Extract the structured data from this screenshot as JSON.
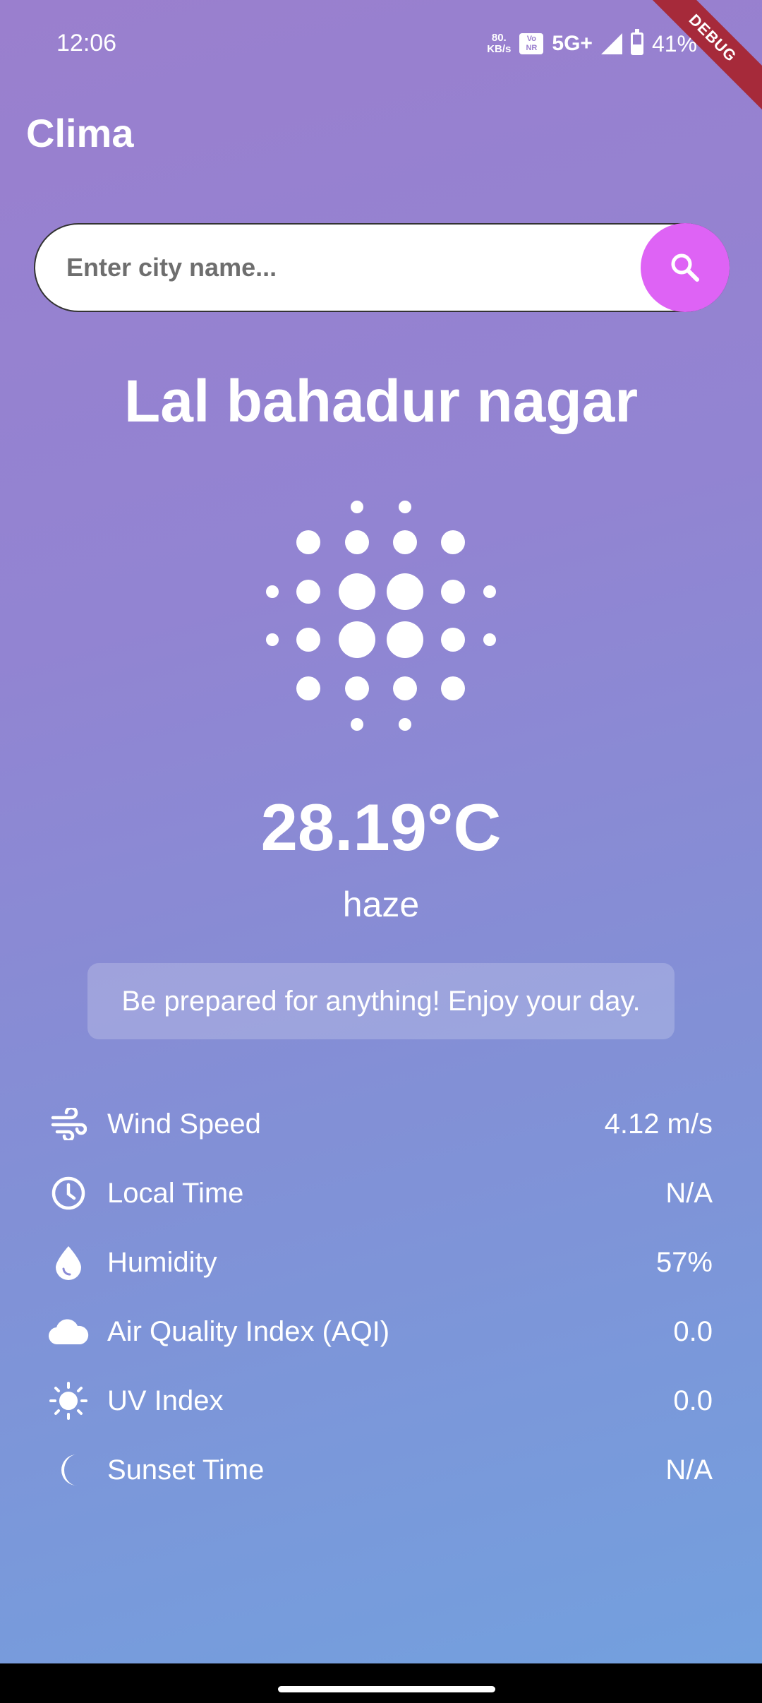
{
  "status_bar": {
    "time": "12:06",
    "net_speed_value": "80.",
    "net_speed_unit": "KB/s",
    "vonr_top": "Vo",
    "vonr_bottom": "NR",
    "network": "5G+",
    "battery": "41%"
  },
  "debug_banner": "DEBUG",
  "app": {
    "title": "Clima"
  },
  "search": {
    "placeholder": "Enter city name...",
    "value": "",
    "button_icon": "search-icon"
  },
  "weather": {
    "city": "Lal bahadur nagar",
    "icon": "haze-dots-icon",
    "temperature": "28.19°C",
    "description": "haze",
    "message": "Be prepared for anything! Enjoy your day."
  },
  "details": [
    {
      "icon": "wind-icon",
      "label": "Wind Speed",
      "value": "4.12 m/s"
    },
    {
      "icon": "clock-icon",
      "label": "Local Time",
      "value": "N/A"
    },
    {
      "icon": "water-drop-icon",
      "label": "Humidity",
      "value": "57%"
    },
    {
      "icon": "cloud-icon",
      "label": "Air Quality Index (AQI)",
      "value": "0.0"
    },
    {
      "icon": "sun-icon",
      "label": "UV Index",
      "value": "0.0"
    },
    {
      "icon": "moon-icon",
      "label": "Sunset Time",
      "value": "N/A"
    }
  ],
  "colors": {
    "gradient_top": "#9a7fce",
    "gradient_bottom": "#73a0de",
    "search_button": "#de63f5",
    "debug_ribbon": "#a62a3a"
  }
}
